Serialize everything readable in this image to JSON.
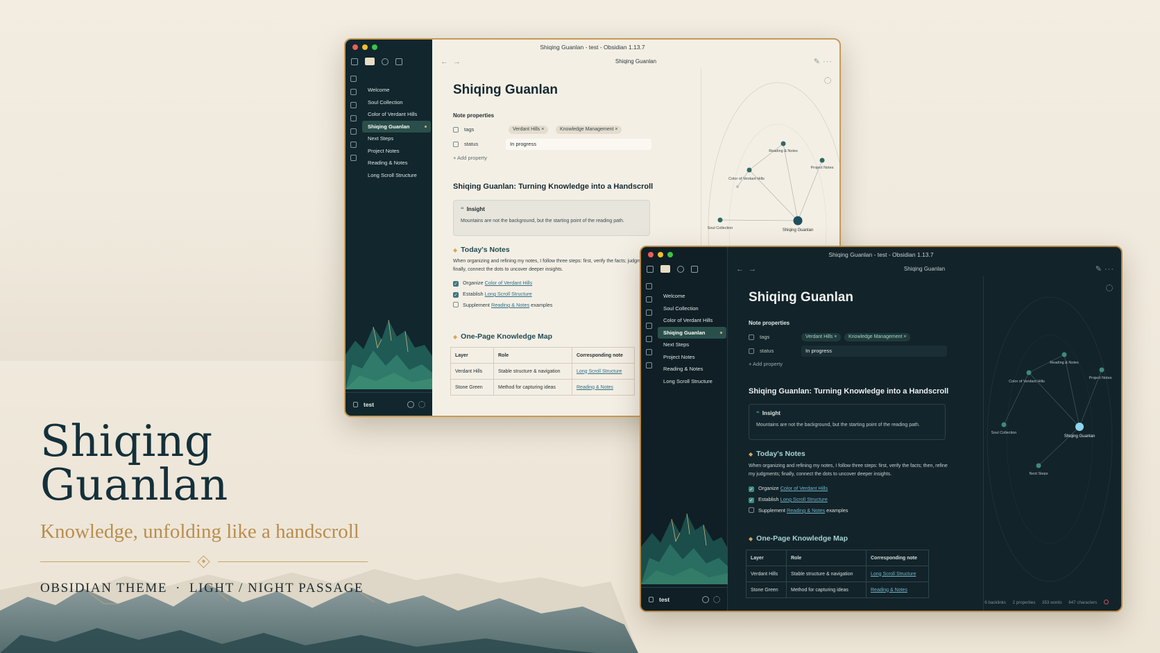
{
  "branding": {
    "title": "Shiqing Guanlan",
    "subtitle": "Knowledge, unfolding like a handscroll",
    "meta_left": "OBSIDIAN THEME",
    "meta_sep": "·",
    "meta_right": "LIGHT / NIGHT PASSAGE"
  },
  "colors": {
    "background": "#f2ece1",
    "accent_gold": "#c9a46d",
    "dark_teal": "#11262d",
    "title_ink": "#14303a"
  },
  "window": {
    "title": "Shiqing Guanlan - test - Obsidian 1.13.7",
    "tab_title": "Shiqing Guanlan",
    "files": [
      "Welcome",
      "Soul Collection",
      "Color of Verdant Hills",
      "Shiqing Guanlan",
      "Next Steps",
      "Project Notes",
      "Reading & Notes",
      "Long Scroll Structure"
    ],
    "active_file": "Shiqing Guanlan",
    "vault": "test"
  },
  "note": {
    "title": "Shiqing Guanlan",
    "properties_heading": "Note properties",
    "tags_key": "tags",
    "tags": [
      "Verdant Hills ×",
      "Knowledge Management ×"
    ],
    "status_key": "status",
    "status_value": "In progress",
    "add_property": "+ Add property",
    "h2": "Shiqing Guanlan: Turning Knowledge into a Handscroll",
    "callout_title": "Insight",
    "callout_body": "Mountains are not the background, but the starting point of the reading path.",
    "todays_notes_heading": "Today's Notes",
    "todays_notes_text_light": "When organizing and refining my notes, I follow three steps: first, verify the facts; judgments; finally, connect the dots to uncover deeper insights.",
    "todays_notes_text_dark": "When organizing and refining my notes, I follow three steps: first, verify the facts; then, refine my judgments; finally, connect the dots to uncover deeper insights.",
    "tasks": [
      {
        "prefix": "Organize ",
        "link": "Color of Verdant Hills",
        "suffix": "",
        "checked": true
      },
      {
        "prefix": "Establish ",
        "link": "Long Scroll Structure",
        "suffix": "",
        "checked": true
      },
      {
        "prefix": "Supplement ",
        "link": "Reading & Notes",
        "suffix": " examples",
        "checked": false
      }
    ],
    "map_heading": "One-Page Knowledge Map",
    "table": {
      "headers": [
        "Layer",
        "Role",
        "Corresponding note"
      ],
      "rows": [
        [
          "Verdant Hills",
          "Stable structure & navigation",
          "Long Scroll Structure"
        ],
        [
          "Stone Green",
          "Method for capturing ideas",
          "Reading & Notes"
        ]
      ]
    }
  },
  "graph": {
    "nodes_light": [
      "Reading & Notes",
      "Project Notes",
      "Color of Verdant Hills",
      "Soul Collection",
      "Shiqing Guanlan"
    ],
    "nodes_dark": [
      "Reading & Notes",
      "Project Notes",
      "Color of Verdant Hills",
      "Soul Collection",
      "Shiqing Guanlan",
      "Next Steps"
    ]
  },
  "status_bar": {
    "backlinks": "6 backlinks",
    "properties": "2 properties",
    "words": "353 words",
    "characters": "647 characters"
  }
}
